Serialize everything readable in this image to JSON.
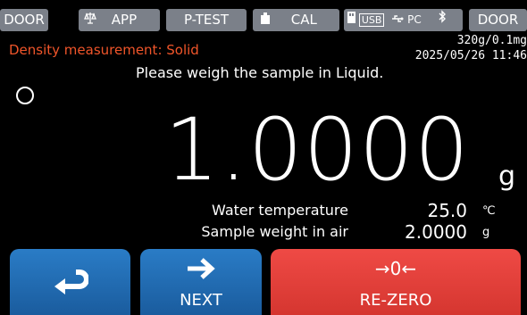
{
  "topbar": {
    "door_left": "DOOR",
    "app": "APP",
    "ptest": "P-TEST",
    "cal": "CAL",
    "usb": "USB",
    "pc": "PC",
    "door_right": "DOOR"
  },
  "status": {
    "mode": "Density measurement: Solid",
    "capacity": "320g/0.1mg",
    "datetime": "2025/05/26 11:46"
  },
  "instruction": "Please weigh the sample in Liquid.",
  "reading": {
    "value": "1.0000",
    "unit": "g"
  },
  "details": [
    {
      "label": "Water temperature",
      "value": "25.0",
      "unit": "℃"
    },
    {
      "label": "Sample weight in air",
      "value": "2.0000",
      "unit": "g"
    }
  ],
  "buttons": {
    "next": "NEXT",
    "rezero_glyph": "→0←",
    "rezero": "RE-ZERO"
  },
  "colors": {
    "accent_red": "#f0552a",
    "button_blue": "#1f6fb5",
    "button_red": "#e8413d",
    "tab_gray": "#7b8089"
  }
}
